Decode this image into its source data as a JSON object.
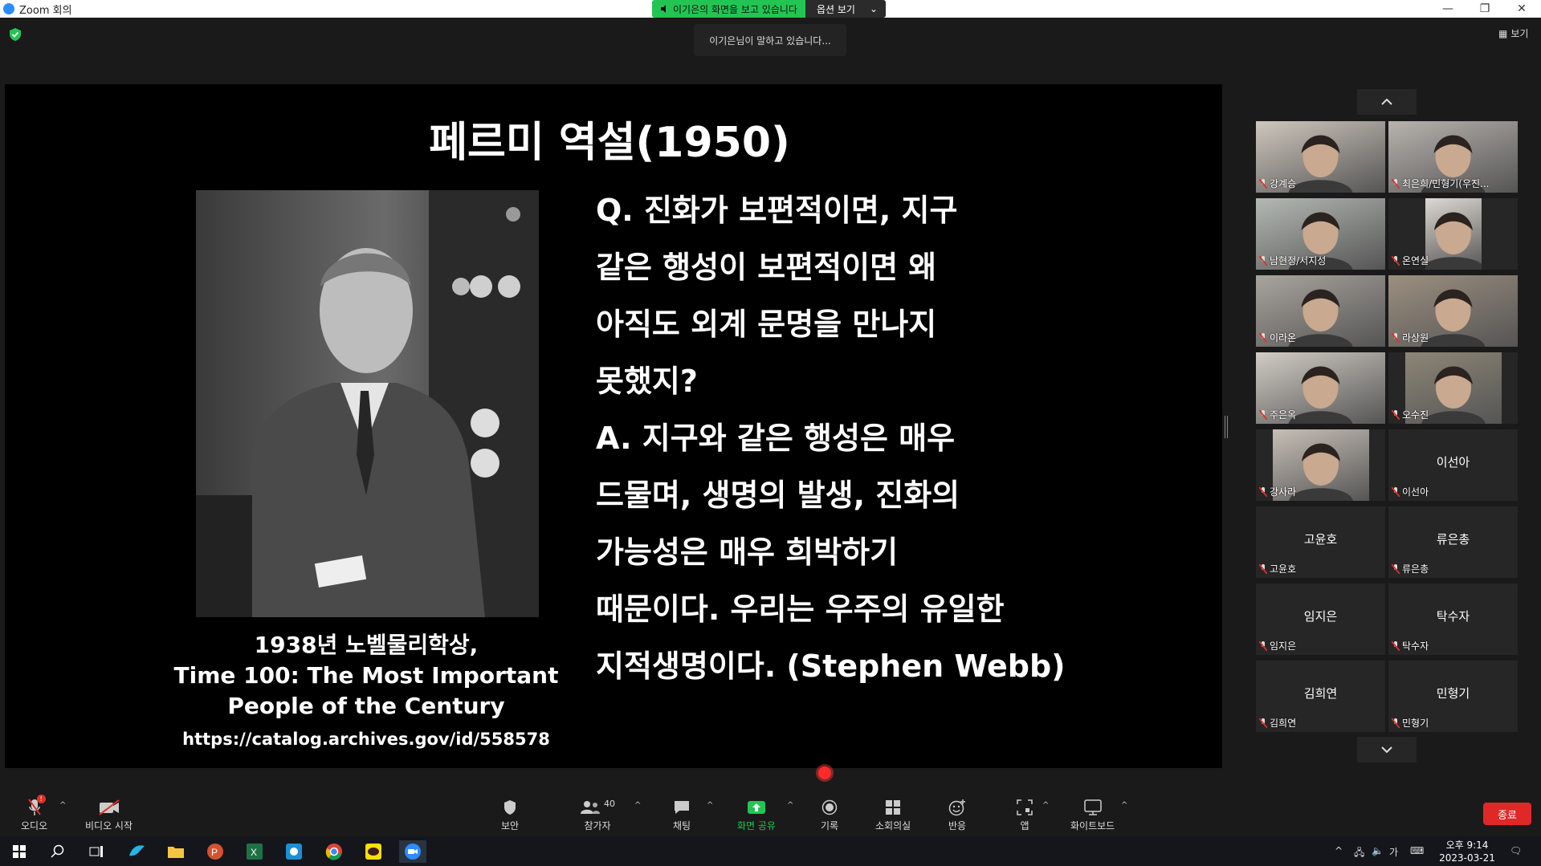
{
  "window": {
    "title": "Zoom 회의",
    "viewing_banner": "이기은의 화면을 보고 있습니다",
    "view_options": "옵션 보기",
    "talking": "이기은님이 말하고 있습니다...",
    "view_button": "보기"
  },
  "slide": {
    "title": "페르미 역설(1950)",
    "caption_line1": "1938년 노벨물리학상,",
    "caption_line2": "Time 100: The Most Important",
    "caption_line3": "People of the Century",
    "caption_url": "https://catalog.archives.gov/id/558578",
    "text_lines": [
      "Q. 진화가 보편적이면, 지구",
      "같은 행성이 보편적이면 왜",
      "아직도 외계 문명을 만나지",
      "못했지?",
      "A. 지구와 같은 행성은 매우",
      "드물며, 생명의 발생, 진화의",
      "가능성은 매우 희박하기",
      "때문이다. 우리는 우주의 유일한",
      "지적생명이다. (Stephen Webb)"
    ]
  },
  "participants": [
    {
      "name": "강계승",
      "big": ""
    },
    {
      "name": "최은희/민형기(우진...",
      "big": ""
    },
    {
      "name": "남현정/서지성",
      "big": ""
    },
    {
      "name": "온연실",
      "big": ""
    },
    {
      "name": "이라온",
      "big": ""
    },
    {
      "name": "라상원",
      "big": ""
    },
    {
      "name": "주은옥",
      "big": ""
    },
    {
      "name": "오수진",
      "big": ""
    },
    {
      "name": "강사라",
      "big": ""
    },
    {
      "name": "이선아",
      "big": "이선아"
    },
    {
      "name": "고윤호",
      "big": "고윤호"
    },
    {
      "name": "류은총",
      "big": "류은총"
    },
    {
      "name": "임지은",
      "big": "임지은"
    },
    {
      "name": "탁수자",
      "big": "탁수자"
    },
    {
      "name": "김희연",
      "big": "김희연"
    },
    {
      "name": "민형기",
      "big": "민형기"
    }
  ],
  "toolbar": {
    "audio": "오디오",
    "audio_badge": "!",
    "video": "비디오 시작",
    "security": "보안",
    "participants": "참가자",
    "participant_count": "40",
    "chat": "채팅",
    "share": "화면 공유",
    "record": "기록",
    "breakout": "소회의실",
    "reactions": "반응",
    "apps": "앱",
    "whiteboard": "화이트보드",
    "end": "종료"
  },
  "taskbar": {
    "time": "오후 9:14",
    "date": "2023-03-21",
    "ime": "가"
  },
  "colors": {
    "share_green": "#23c552",
    "end_red": "#e02828",
    "mute_red": "#e0302a"
  }
}
